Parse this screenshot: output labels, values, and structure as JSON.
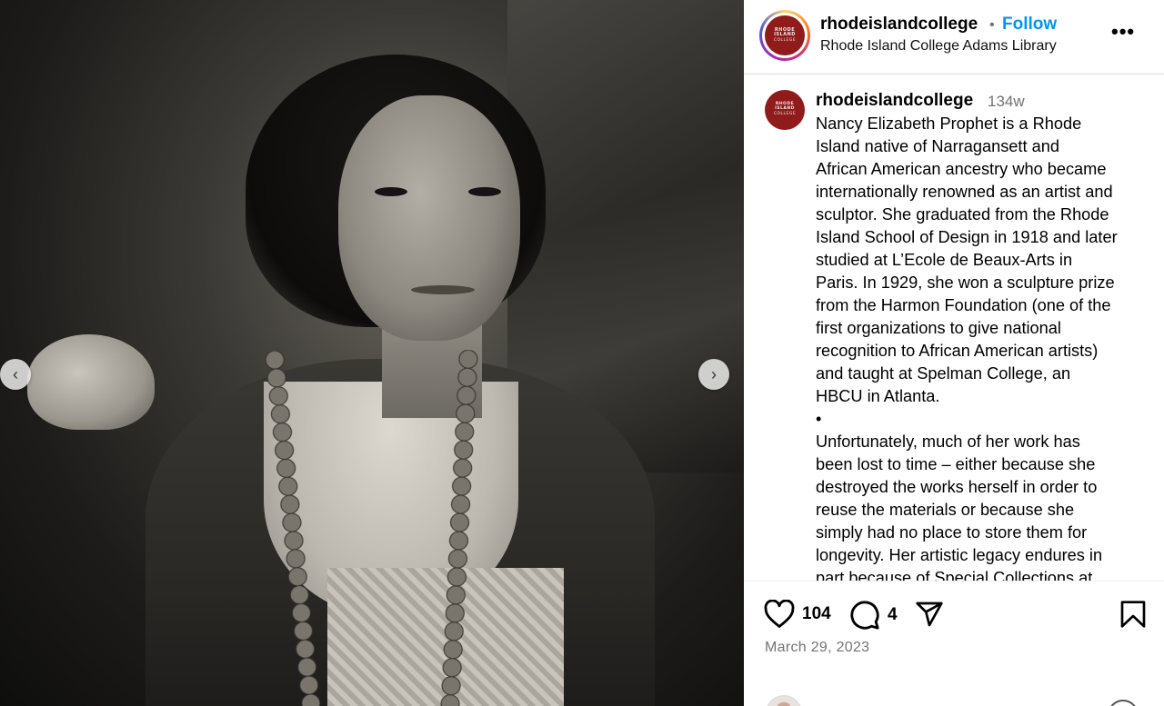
{
  "post": {
    "username": "rhodeislandcollege",
    "follow_label": "Follow",
    "separator": "•",
    "location": "Rhode Island College Adams Library",
    "more_label": "•••",
    "logo": {
      "line1": "RHODE",
      "line2": "ISLAND",
      "line3": "COLLEGE"
    }
  },
  "carousel": {
    "prev_label": "‹",
    "next_label": "›"
  },
  "caption": {
    "username": "rhodeislandcollege",
    "time": "134w",
    "text": "Nancy Elizabeth Prophet is a Rhode\nIsland native of Narragansett and\nAfrican American ancestry who became\ninternationally renowned as an artist and\nsculptor. She graduated from the Rhode\nIsland School of Design in 1918 and later\nstudied at L’Ecole de Beaux-Arts in\nParis. In 1929, she won a sculpture prize\nfrom the Harmon Foundation (one of the\nfirst organizations to give national\nrecognition to African American artists)\nand taught at Spelman College, an\nHBCU in Atlanta.\n•\nUnfortunately, much of her work has\nbeen lost to time – either because she\ndestroyed the works herself in order to\nreuse the materials or because she\nsimply had no place to store them for\nlongevity. Her artistic legacy endures in\npart because of Special Collections at"
  },
  "actions": {
    "likes": "104",
    "comments": "4",
    "date": "March 29, 2023",
    "icons": [
      "heart-icon",
      "comment-icon",
      "share-icon",
      "bookmark-icon"
    ]
  },
  "colors": {
    "follow": "#0095f6",
    "logo_bg": "#8f1b1b",
    "muted": "#737373"
  }
}
